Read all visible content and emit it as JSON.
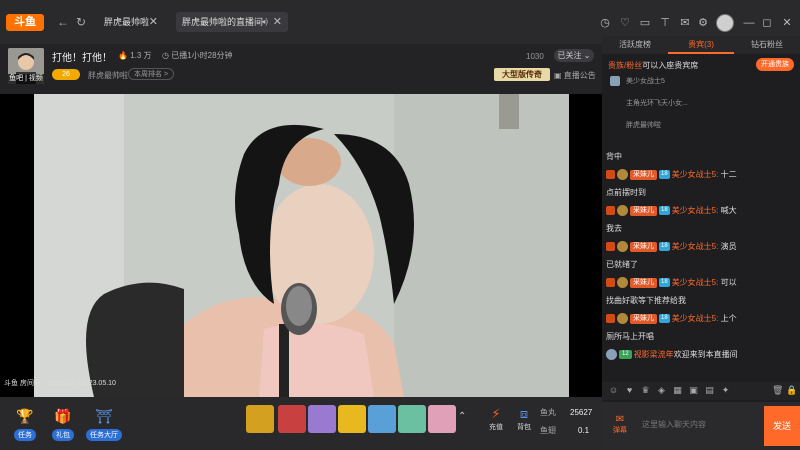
{
  "titlebar": {
    "logo": "斗鱼",
    "tabs": [
      {
        "label": "胖虎最帅啦"
      },
      {
        "label": "胖虎最帅啦的直播间"
      }
    ]
  },
  "streamer": {
    "avatar_label": "鱼吧 | 视频",
    "room_title": "打他！打他！",
    "hot": "1.3 万",
    "live_time": "已播1小时28分钟",
    "level": "26",
    "anchor_name": "胖虎最帅啦",
    "rank_btn": "本周排名 >",
    "fans": "1030",
    "follow": "已关注",
    "ad_banner": "大型版传奇",
    "notice": "直播公告"
  },
  "video": {
    "watermark": "斗鱼 房间号：9253131 | 2023.05.10"
  },
  "bottombar": {
    "task": "任务",
    "gift_box": "礼包",
    "event_hall": "任务大厅",
    "recharge": "充值",
    "backpack": "背包",
    "fish_ball_label": "鱼丸",
    "fish_ball_value": "25627",
    "fish_fin_label": "鱼翅",
    "fish_fin_value": "0.1"
  },
  "right_panel": {
    "tabs": [
      "活跃度榜",
      "贵宾(3)",
      "钻石粉丝"
    ],
    "vip_title_highlight": "贵族/粉丝",
    "vip_title_rest": "可以入座贵宾席",
    "vip_open": "开通贵族",
    "vip_list": [
      "美少女战士5",
      "主角光环飞天小女...",
      "胖虎最帅啦"
    ],
    "chat": [
      {
        "text": "背中"
      },
      {
        "badge": "采妹儿",
        "lv": "18",
        "uname": "美少女战士5:",
        "text": "十二"
      },
      {
        "text": "点前摆时到"
      },
      {
        "badge": "采妹儿",
        "lv": "18",
        "uname": "美少女战士5:",
        "text": "喊大"
      },
      {
        "text": "我去"
      },
      {
        "badge": "采妹儿",
        "lv": "18",
        "uname": "美少女战士5:",
        "text": "演员"
      },
      {
        "text": "已就绪了"
      },
      {
        "badge": "采妹儿",
        "lv": "18",
        "uname": "美少女战士5:",
        "text": "可以"
      },
      {
        "text": "找曲好歌等下推荐给我"
      },
      {
        "badge": "采妹儿",
        "lv": "18",
        "uname": "美少女战士5:",
        "text": "上个"
      },
      {
        "text": "厕所马上开唱"
      },
      {
        "welcome_tag": "12",
        "wname": "视影梁流年",
        "text": "欢迎来到本直播间"
      }
    ],
    "input_left": "弹幕",
    "input_placeholder": "这里输入聊天内容",
    "send": "发送"
  },
  "colors": {
    "accent": "#ff6a2a",
    "bg": "#1e1e20"
  }
}
